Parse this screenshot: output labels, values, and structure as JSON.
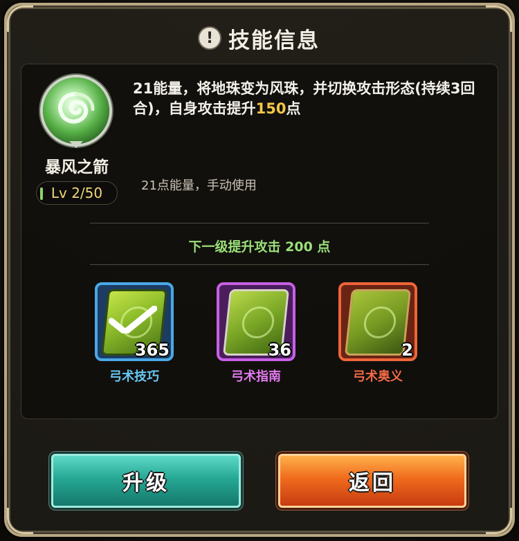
{
  "dialog": {
    "title": "技能信息"
  },
  "skill": {
    "name": "暴风之箭",
    "level": "Lv 2/50",
    "description_prefix": "21能量，将地珠变为风珠，并切换攻击形态(持续3回合)，自身攻击提升",
    "description_value": "150",
    "description_suffix": "点",
    "sub_description": "21点能量，手动使用",
    "next_level": "下一级提升攻击 200 点"
  },
  "books": [
    {
      "name": "弓术技巧",
      "count": "365",
      "rarity": "blue",
      "label_color": "#67c8f2",
      "frame_color": "#46a6e2",
      "selected": true
    },
    {
      "name": "弓术指南",
      "count": "36",
      "rarity": "purple",
      "label_color": "#e27af0",
      "frame_color": "#c660e5",
      "selected": false
    },
    {
      "name": "弓术奥义",
      "count": "2",
      "rarity": "orange",
      "label_color": "#f26a46",
      "frame_color": "#ef6538",
      "selected": false
    }
  ],
  "buttons": {
    "upgrade": "升级",
    "back": "返回"
  },
  "icons": {
    "title_icon": "info-icon",
    "skill_icon": "wind-swirl-icon",
    "book_icon": "bow-book-icon",
    "selected_icon": "checkmark-icon"
  },
  "colors": {
    "highlight": "#f4c84a",
    "next_level": "#9be07a",
    "level_text": "#f1d77a"
  }
}
